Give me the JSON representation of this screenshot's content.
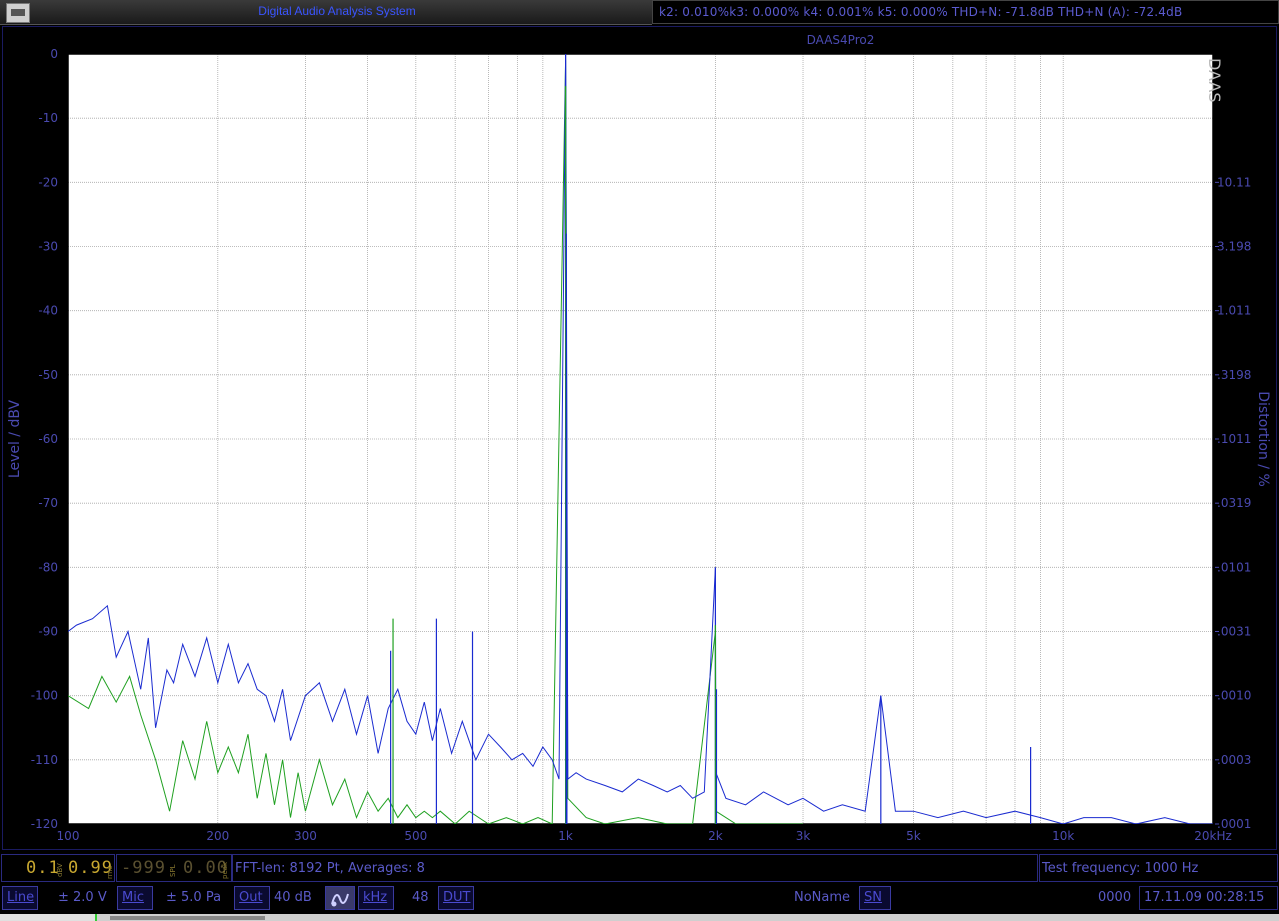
{
  "window": {
    "title": "Digital Audio Analysis System"
  },
  "distortion_readout": "k2: 0.010%k3: 0.000% k4: 0.001% k5: 0.000% THD+N: -71.8dB THD+N (A): -72.4dB",
  "chart_data": {
    "type": "line",
    "title": "DAAS4Pro2",
    "watermark": "DAAS",
    "xlabel": "",
    "ylabel": "Level / dBV",
    "ylabel_right": "Distortion / %",
    "x_scale": "log",
    "xlim": [
      100,
      20000
    ],
    "ylim": [
      -120,
      0
    ],
    "x_ticks": [
      100,
      200,
      300,
      500,
      1000,
      2000,
      3000,
      5000,
      10000,
      20000
    ],
    "x_tick_labels": [
      "100",
      "200",
      "300",
      "500",
      "1k",
      "2k",
      "3k",
      "5k",
      "10k",
      "20kHz"
    ],
    "y_ticks": [
      0,
      -10,
      -20,
      -30,
      -40,
      -50,
      -60,
      -70,
      -80,
      -90,
      -100,
      -110,
      -120
    ],
    "y_tick_labels": [
      "0",
      "-10",
      "-20",
      "-30",
      "-40",
      "-50",
      "-60",
      "-70",
      "-80",
      "-90",
      "-100",
      "-110",
      "-120"
    ],
    "y2_tick_labels": [
      {
        "y": -20,
        "label": "10.11"
      },
      {
        "y": -30,
        "label": "3.198"
      },
      {
        "y": -40,
        "label": "1.011"
      },
      {
        "y": -50,
        "label": ".3198"
      },
      {
        "y": -60,
        "label": ".1011"
      },
      {
        "y": -70,
        "label": ".0319"
      },
      {
        "y": -80,
        "label": ".0101"
      },
      {
        "y": -90,
        "label": ".0031"
      },
      {
        "y": -100,
        "label": ".0010"
      },
      {
        "y": -110,
        "label": ".0003"
      },
      {
        "y": -120,
        "label": ".0001"
      }
    ],
    "grid": true,
    "colors": {
      "blue": "#1a2bd0",
      "green": "#1fa020",
      "grid": "#a8a8a8",
      "axis_text": "#4a4ab0"
    },
    "series": [
      {
        "color": "#1a2bd0",
        "x": [
          100,
          104,
          112,
          120,
          125,
          132,
          140,
          145,
          150,
          158,
          163,
          170,
          180,
          190,
          200,
          210,
          220,
          230,
          240,
          250,
          260,
          270,
          280,
          300,
          320,
          340,
          360,
          380,
          400,
          420,
          440,
          460,
          480,
          500,
          520,
          540,
          560,
          590,
          620,
          660,
          700,
          740,
          780,
          820,
          860,
          900,
          940,
          970,
          1000,
          1003,
          1010,
          1050,
          1100,
          1200,
          1300,
          1400,
          1500,
          1600,
          1700,
          1800,
          1900,
          2000,
          2005,
          2100,
          2300,
          2500,
          2800,
          3000,
          3300,
          3600,
          4000,
          4300,
          4600,
          5000,
          5600,
          6300,
          7000,
          8000,
          9000,
          10000,
          11000,
          12500,
          14000,
          16000,
          18000,
          20000
        ],
        "y": [
          -90,
          -89,
          -88,
          -86,
          -94,
          -90,
          -99,
          -91,
          -105,
          -96,
          -98,
          -92,
          -97,
          -91,
          -98,
          -92,
          -98,
          -95,
          -99,
          -100,
          -104,
          -99,
          -107,
          -100,
          -98,
          -104,
          -99,
          -106,
          -100,
          -109,
          -102,
          -99,
          -104,
          -106,
          -101,
          -107,
          -102,
          -109,
          -104,
          -110,
          -106,
          -108,
          -110,
          -109,
          -111,
          -108,
          -110,
          -113,
          0,
          -28,
          -113,
          -112,
          -113,
          -114,
          -115,
          -113,
          -114,
          -115,
          -114,
          -116,
          -115,
          -80,
          -112,
          -116,
          -117,
          -115,
          -117,
          -116,
          -118,
          -117,
          -118,
          -100,
          -118,
          -118,
          -119,
          -118,
          -119,
          -118,
          -119,
          -120,
          -119,
          -119,
          -120,
          -119,
          -120,
          -120
        ]
      },
      {
        "color": "#1fa020",
        "x": [
          100,
          110,
          117,
          125,
          133,
          140,
          150,
          160,
          170,
          180,
          190,
          200,
          210,
          220,
          230,
          240,
          250,
          260,
          270,
          280,
          290,
          300,
          320,
          340,
          360,
          380,
          400,
          420,
          440,
          460,
          480,
          500,
          520,
          540,
          560,
          600,
          640,
          700,
          760,
          820,
          880,
          940,
          1000,
          1003,
          1010,
          1100,
          1200,
          1400,
          1600,
          1800,
          2000,
          2005,
          2200,
          2600,
          3000
        ],
        "y": [
          -100,
          -102,
          -97,
          -101,
          -97,
          -103,
          -110,
          -118,
          -107,
          -113,
          -104,
          -112,
          -108,
          -112,
          -106,
          -116,
          -109,
          -117,
          -110,
          -119,
          -112,
          -118,
          -110,
          -117,
          -113,
          -119,
          -115,
          -118,
          -116,
          -119,
          -117,
          -119,
          -118,
          -119,
          -118,
          -120,
          -118,
          -120,
          -119,
          -120,
          -119,
          -120,
          -1,
          -35,
          -116,
          -119,
          -120,
          -119,
          -120,
          -120,
          -90,
          -118,
          -120,
          -120,
          -120
        ]
      }
    ],
    "spikes": [
      {
        "x": 1000,
        "y": 0,
        "color": "#1a2bd0"
      },
      {
        "x": 1000,
        "y": -5,
        "color": "#1fa020"
      },
      {
        "x": 1003,
        "y": -28,
        "color": "#1a2bd0"
      },
      {
        "x": 1006,
        "y": -85,
        "color": "#1a2bd0"
      },
      {
        "x": 450,
        "y": -88,
        "color": "#1fa020"
      },
      {
        "x": 445,
        "y": -93,
        "color": "#1a2bd0"
      },
      {
        "x": 550,
        "y": -88,
        "color": "#1a2bd0"
      },
      {
        "x": 650,
        "y": -90,
        "color": "#1a2bd0"
      },
      {
        "x": 2000,
        "y": -80,
        "color": "#1a2bd0"
      },
      {
        "x": 2000,
        "y": -89,
        "color": "#1fa020"
      },
      {
        "x": 2010,
        "y": -99,
        "color": "#1a2bd0"
      },
      {
        "x": 4300,
        "y": -100,
        "color": "#1a2bd0"
      },
      {
        "x": 8600,
        "y": -108,
        "color": "#1a2bd0"
      }
    ]
  },
  "status_bar_1": {
    "meter_level": "0.1",
    "meter_level_unit": "dBV",
    "meter_rms": "0.99",
    "meter_rms_unit": "rms",
    "spl_value": "-999",
    "spl_unit": "SPL",
    "peak_value": "0.00",
    "peak_unit": "peak",
    "fft_info": "FFT-len: 8192 Pt, Averages: 8",
    "test_frequency": "Test frequency: 1000 Hz"
  },
  "status_bar_2": {
    "line_button": "Line",
    "line_range": "± 2.0 V",
    "mic_button": "Mic",
    "mic_range": "± 5.0 Pa",
    "out_button": "Out",
    "out_gain": "40 dB",
    "khz_button": "kHz",
    "sample_rate": "48",
    "dut_button": "DUT",
    "device_name": "NoName",
    "sn_button": "SN",
    "serial": "0000",
    "datetime": "17.11.09 00:28:15"
  }
}
